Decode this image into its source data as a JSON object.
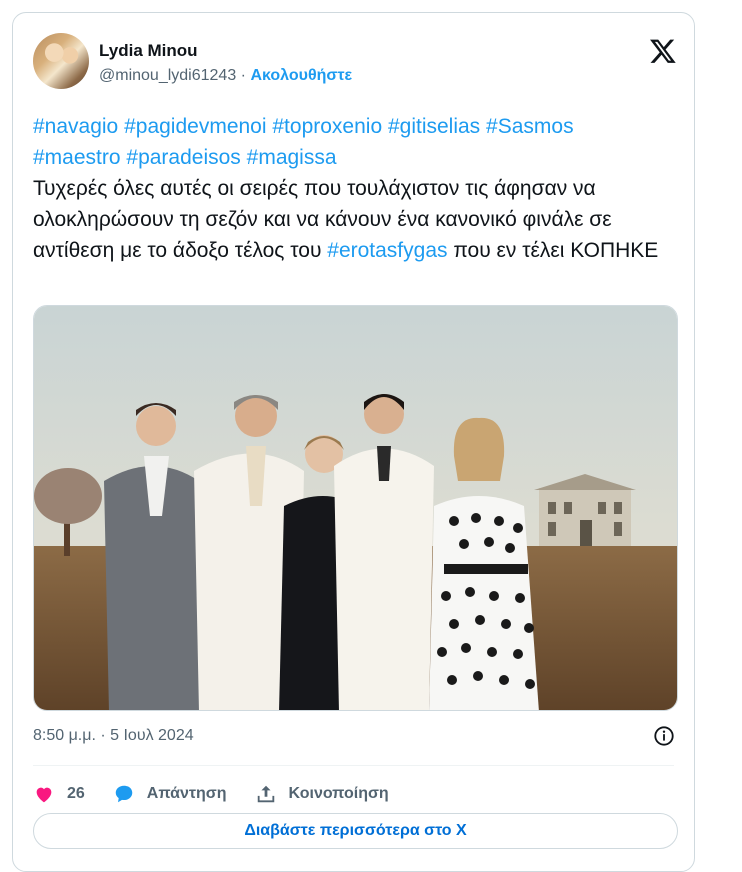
{
  "tweet": {
    "author_name": "Lydia Minou",
    "handle": "@minou_lydi61243",
    "separator": "·",
    "follow_label": "Ακολουθήστε",
    "hashtags_line1": [
      "#navagio",
      "#pagidevmenoi",
      "#toproxenio",
      "#gitiselias",
      "#Sasmos"
    ],
    "hashtags_line2": [
      "#maestro",
      "#paradeisos",
      "#magissa"
    ],
    "body_text": "Τυχερές όλες αυτές οι σειρές που τουλάχιστον τις άφησαν να ολοκληρώσουν τη σεζόν και να κάνουν ένα κανονικό φινάλε σε αντίθεση με το άδοξο τέλος του",
    "final_hashtag": "#erotasfygas",
    "final_text": "που εν τέλει ΚΟΠΗΚΕ",
    "timestamp": "8:50 μ.μ. · 5 Ιουλ 2024",
    "likes_count": "26",
    "reply_label": "Απάντηση",
    "share_label": "Κοινοποίηση",
    "read_more_label": "Διαβάστε περισσότερα στο X"
  },
  "icons": {
    "x_logo": "x-logo-icon",
    "info": "info-icon",
    "like": "heart-icon",
    "reply": "speech-bubble-icon",
    "share": "upload-arrow-icon"
  },
  "colors": {
    "link": "#1d9bf0",
    "like": "#f91880",
    "muted": "#536471",
    "border": "#cfd9de"
  }
}
